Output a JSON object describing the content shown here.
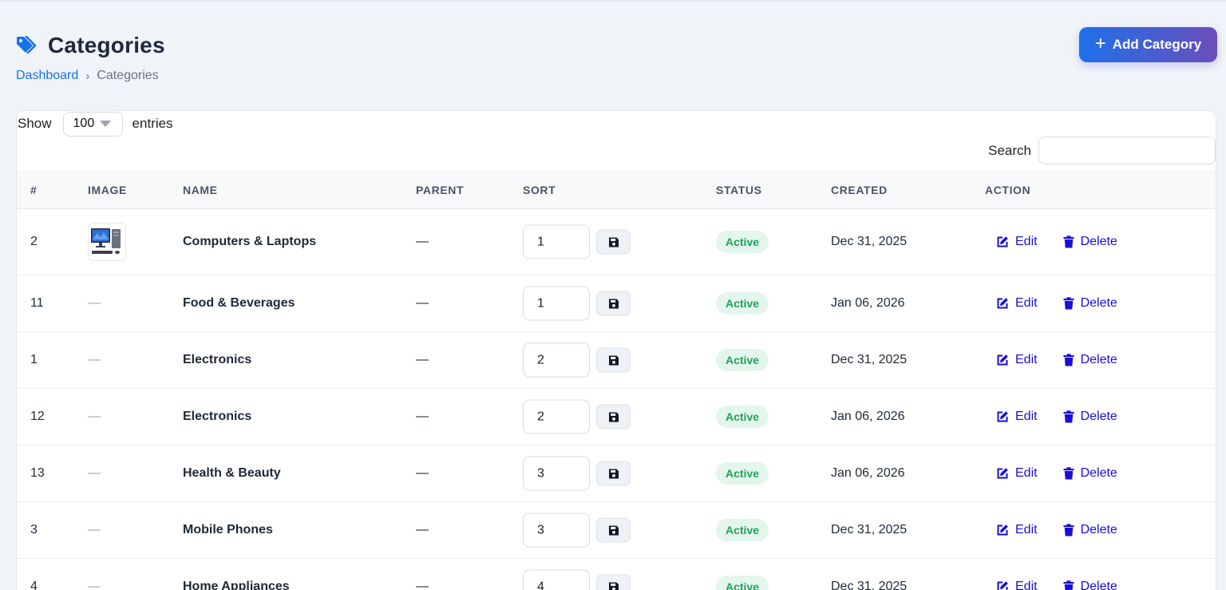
{
  "header": {
    "title": "Categories",
    "breadcrumb": {
      "home": "Dashboard",
      "separator": "›",
      "current": "Categories"
    },
    "add_button_label": "Add Category"
  },
  "controls": {
    "show_label": "Show",
    "page_length": "100",
    "entries_label": "entries",
    "search_label": "Search",
    "search_value": ""
  },
  "columns": [
    "#",
    "IMAGE",
    "NAME",
    "PARENT",
    "SORT",
    "STATUS",
    "CREATED",
    "ACTION"
  ],
  "rows": [
    {
      "id": "2",
      "image": "computer-thumbnail",
      "name": "Computers & Laptops",
      "parent": "—",
      "sort": "1",
      "status": "Active",
      "created": "Dec 31, 2025"
    },
    {
      "id": "11",
      "image": "—",
      "name": "Food & Beverages",
      "parent": "—",
      "sort": "1",
      "status": "Active",
      "created": "Jan 06, 2026"
    },
    {
      "id": "1",
      "image": "—",
      "name": "Electronics",
      "parent": "—",
      "sort": "2",
      "status": "Active",
      "created": "Dec 31, 2025"
    },
    {
      "id": "12",
      "image": "—",
      "name": "Electronics",
      "parent": "—",
      "sort": "2",
      "status": "Active",
      "created": "Jan 06, 2026"
    },
    {
      "id": "13",
      "image": "—",
      "name": "Health & Beauty",
      "parent": "—",
      "sort": "3",
      "status": "Active",
      "created": "Jan 06, 2026"
    },
    {
      "id": "3",
      "image": "—",
      "name": "Mobile Phones",
      "parent": "—",
      "sort": "3",
      "status": "Active",
      "created": "Dec 31, 2025"
    },
    {
      "id": "4",
      "image": "—",
      "name": "Home Appliances",
      "parent": "—",
      "sort": "4",
      "status": "Active",
      "created": "Dec 31, 2025"
    }
  ],
  "actions": {
    "edit_label": "Edit",
    "delete_label": "Delete"
  },
  "colors": {
    "accent": "#1a73e8",
    "action_link": "#1a0fd6",
    "badge_bg": "#e3f6ec",
    "badge_text": "#22a05a",
    "button_gradient_start": "#1f6fea",
    "button_gradient_end": "#6b4fbb"
  },
  "icons": {
    "title": "tags-icon",
    "add": "plus-icon",
    "save": "floppy-disk-icon",
    "edit": "edit-icon",
    "delete": "trash-icon"
  }
}
